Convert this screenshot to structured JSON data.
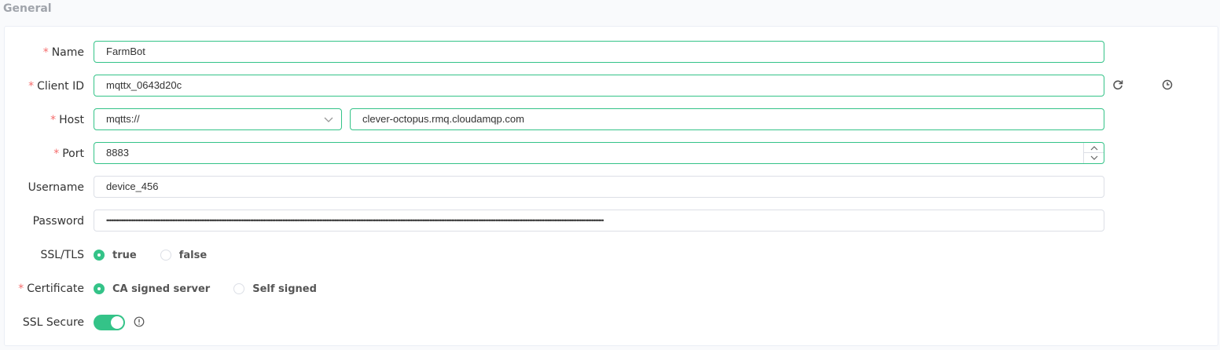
{
  "section": {
    "title": "General"
  },
  "form": {
    "name": {
      "label": "Name",
      "value": "FarmBot"
    },
    "client_id": {
      "label": "Client ID",
      "value": "mqttx_0643d20c"
    },
    "host": {
      "label": "Host",
      "protocol": "mqtts://",
      "value": "clever-octopus.rmq.cloudamqp.com"
    },
    "port": {
      "label": "Port",
      "value": "8883"
    },
    "username": {
      "label": "Username",
      "value": "device_456"
    },
    "password": {
      "label": "Password",
      "value": "••••••••••••••••••••••••••••••••••••••••••••••••••••••••••••••••••••••••••••••••••••••••••••••••••••••••••••••••••••••••••••••••••••••••••••••••••••••••••••••••••••••••••••••••••••••••••••••••••••••••••••••••••••••••••••••••••••••••••••••••••••••••••••••••••••••••••••••••••••••••••••••••••••••"
    },
    "ssl_tls": {
      "label": "SSL/TLS",
      "options": [
        "true",
        "false"
      ],
      "selected": "true"
    },
    "certificate": {
      "label": "Certificate",
      "options": [
        "CA signed server",
        "Self signed"
      ],
      "selected": "CA signed server"
    },
    "ssl_secure": {
      "label": "SSL Secure",
      "enabled": true
    }
  },
  "colors": {
    "accent": "#34c388",
    "required": "#f56c6c"
  },
  "icons": {
    "refresh": "refresh-icon",
    "history": "clock-icon",
    "info": "info-icon",
    "caret": "chevron-down-icon"
  }
}
